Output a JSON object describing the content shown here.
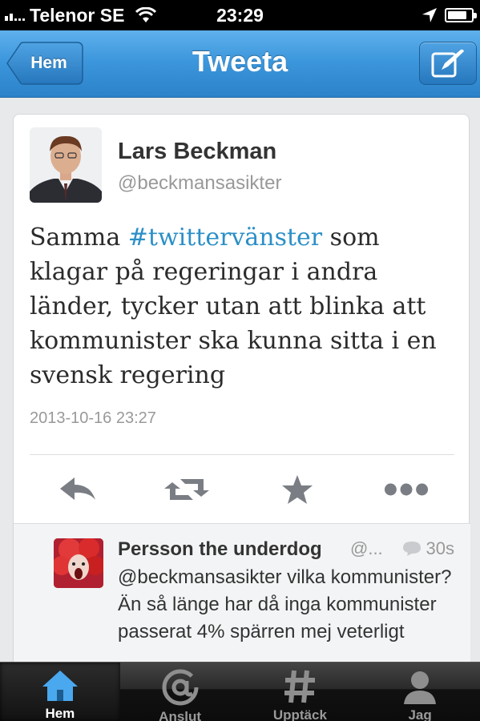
{
  "status_bar": {
    "carrier": "Telenor SE",
    "time": "23:29",
    "battery_level": 0.85
  },
  "nav": {
    "back_label": "Hem",
    "title": "Tweeta",
    "compose_icon": "compose-icon"
  },
  "tweet": {
    "author_name": "Lars Beckman",
    "author_handle": "@beckmansasikter",
    "text_before": "Samma ",
    "hashtag": "#twittervänster",
    "text_after": " som klagar på regeringar i andra länder, tycker utan att blinka att kommunister ska kunna sitta i en svensk regering",
    "timestamp": "2013-10-16 23:27",
    "hashtag_color": "#2b8fc7",
    "actions": [
      "reply-icon",
      "retweet-icon",
      "favorite-icon",
      "more-icon"
    ]
  },
  "reply": {
    "author_name": "Persson the underdog",
    "author_handle": "@...",
    "time": "30s",
    "text": "@beckmansasikter vilka kommunister? Än så länge har då inga kommunister passerat 4% spärren mej veterligt"
  },
  "tab_bar": {
    "tabs": [
      {
        "label": "Hem",
        "icon": "home-icon",
        "active": true
      },
      {
        "label": "Anslut",
        "icon": "at-icon",
        "active": false
      },
      {
        "label": "Upptäck",
        "icon": "hash-icon",
        "active": false
      },
      {
        "label": "Jag",
        "icon": "person-icon",
        "active": false
      }
    ]
  },
  "colors": {
    "nav_blue": "#3d97dc",
    "link_blue": "#2b8fc7",
    "home_icon_blue": "#4aa8ee"
  }
}
